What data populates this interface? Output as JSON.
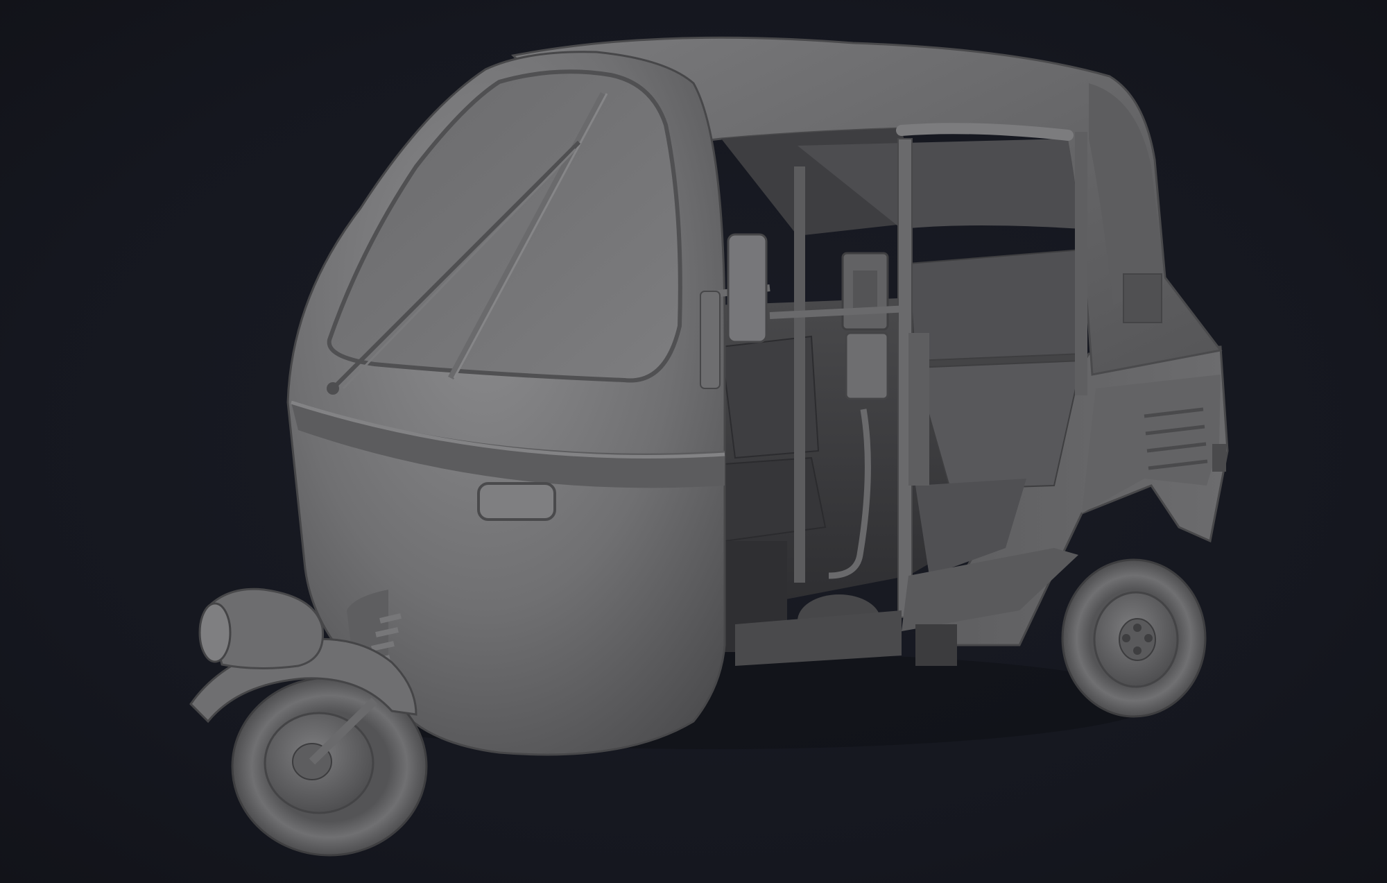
{
  "scene": {
    "subject": "auto-rickshaw-clay-render",
    "background_color": "#15171f",
    "body_color": "#6e6e70",
    "highlight_color": "#8a8a8c",
    "shadow_color": "#3c3c3e",
    "interior_color": "#29292c"
  }
}
